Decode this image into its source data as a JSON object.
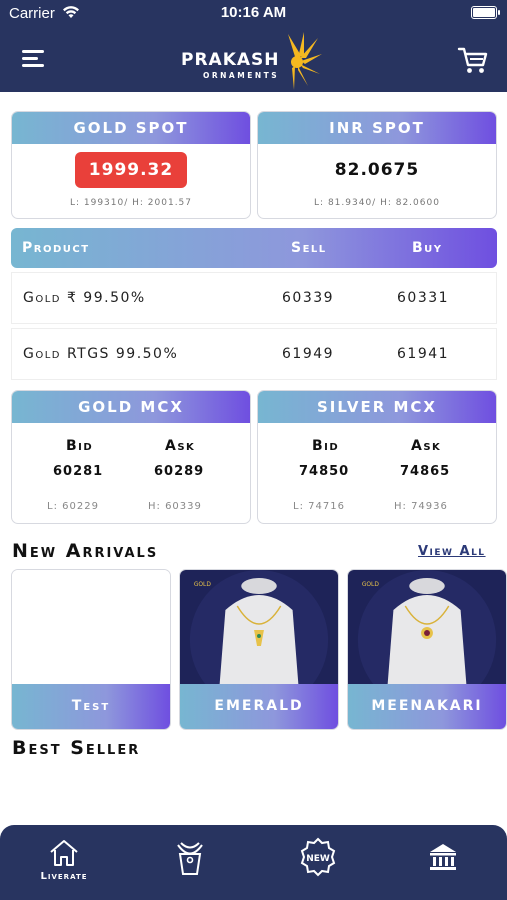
{
  "status_bar": {
    "carrier": "Carrier",
    "time": "10:16 AM"
  },
  "header": {
    "logo_text": "PRAKASH",
    "logo_subtext": "ORNAMENTS"
  },
  "gold_spot": {
    "title": "GOLD SPOT",
    "value": "1999.32",
    "low_high": "L: 199310/ H: 2001.57",
    "value_color": "#e9403a"
  },
  "inr_spot": {
    "title": "INR SPOT",
    "value": "82.0675",
    "low_high": "L: 81.9340/ H: 82.0600"
  },
  "product_table": {
    "headers": {
      "product": "Product",
      "sell": "Sell",
      "buy": "Buy"
    },
    "rows": [
      {
        "product": "Gold ₹ 99.50%",
        "sell": "60339",
        "buy": "60331"
      },
      {
        "product": "Gold RTGS 99.50%",
        "sell": "61949",
        "buy": "61941"
      }
    ]
  },
  "gold_mcx": {
    "title": "GOLD MCX",
    "bid_label": "Bid",
    "ask_label": "Ask",
    "bid": "60281",
    "ask": "60289",
    "low": "L: 60229",
    "high": "H: 60339"
  },
  "silver_mcx": {
    "title": "SILVER MCX",
    "bid_label": "Bid",
    "ask_label": "Ask",
    "bid": "74850",
    "ask": "74865",
    "low": "L: 74716",
    "high": "H: 74936"
  },
  "new_arrivals": {
    "title": "New Arrivals",
    "view_all": "View All",
    "items": [
      {
        "label": "Test"
      },
      {
        "label": "EMERALD"
      },
      {
        "label": "MEENAKARI"
      }
    ]
  },
  "best_seller": {
    "title": "Best Seller"
  },
  "bottom_nav": {
    "items": [
      {
        "label": "Liverate",
        "icon": "home-icon"
      },
      {
        "label": "",
        "icon": "necklace-icon"
      },
      {
        "label": "",
        "icon": "new-badge-icon"
      },
      {
        "label": "",
        "icon": "bank-icon"
      }
    ]
  },
  "colors": {
    "header_bg": "#283460",
    "accent_red": "#e9403a",
    "gradient_start": "#77b6d1",
    "gradient_end": "#6f4fe0"
  }
}
